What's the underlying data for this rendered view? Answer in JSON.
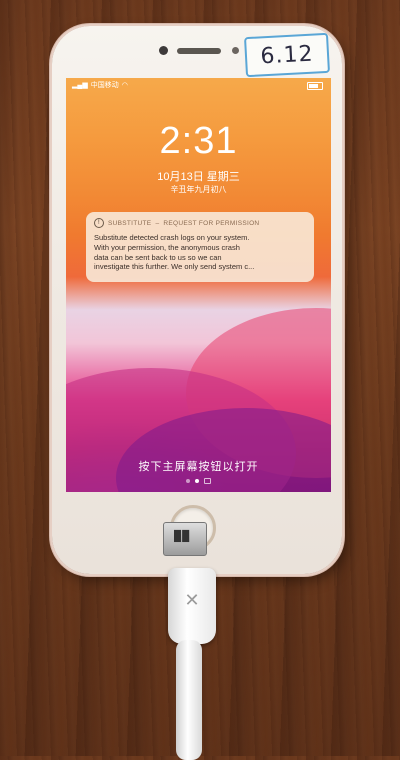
{
  "sticker": {
    "text": "6.12"
  },
  "status_bar": {
    "carrier": "中国移动"
  },
  "lock_screen": {
    "time": "2:31",
    "date": "10月13日 星期三",
    "lunar_date": "辛丑年九月初八",
    "unlock_hint": "按下主屏幕按钮以打开"
  },
  "notification": {
    "app": "SUBSTITUTE",
    "title": "REQUEST FOR PERMISSION",
    "body": "Substitute detected crash logs on your system.\nWith your permission, the anonymous crash\ndata can be sent back to us so we can\ninvestigate this further. We only send system c..."
  },
  "page_dots": {
    "count": 2,
    "active_index": 1
  }
}
